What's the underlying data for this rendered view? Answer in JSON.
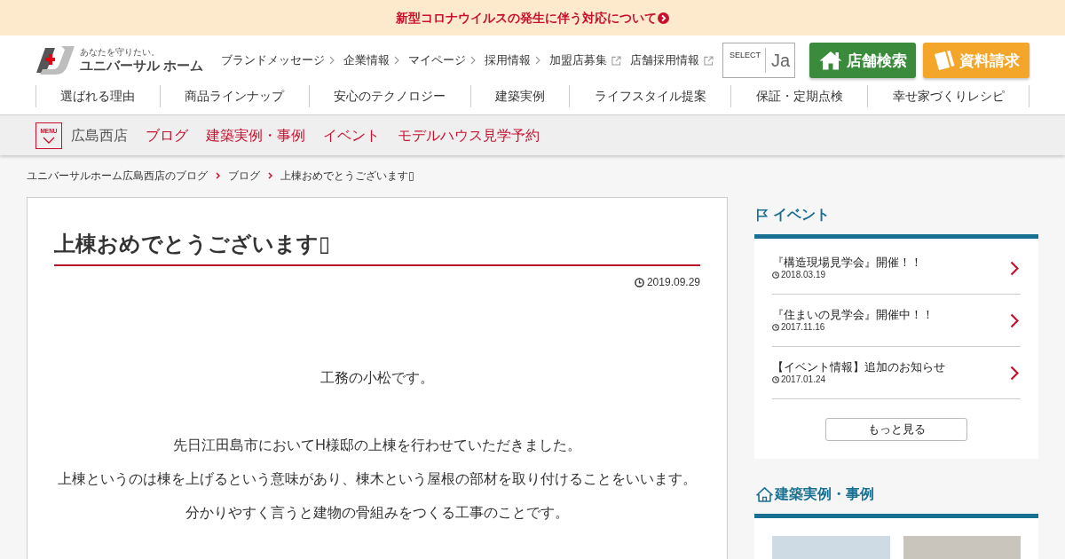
{
  "notice": {
    "text": "新型コロナウイルスの発生に伴う対応について"
  },
  "header": {
    "logo": {
      "tagline": "あなたを守りたい。",
      "name": "ユニバーサル ホーム"
    },
    "utility_links": [
      {
        "label": "ブランドメッセージ",
        "kind": "internal"
      },
      {
        "label": "企業情報",
        "kind": "internal"
      },
      {
        "label": "マイページ",
        "kind": "internal"
      },
      {
        "label": "採用情報",
        "kind": "internal"
      },
      {
        "label": "加盟店募集",
        "kind": "external"
      },
      {
        "label": "店舗採用情報",
        "kind": "external"
      }
    ],
    "language_select": {
      "label": "SELECT",
      "value": "Ja"
    },
    "buttons": [
      {
        "label": "店舗検索",
        "kind": "store"
      },
      {
        "label": "資料請求",
        "kind": "brochure"
      }
    ],
    "nav": [
      "選ばれる理由",
      "商品ラインナップ",
      "安心のテクノロジー",
      "建築実例",
      "ライフスタイル提案",
      "保証・定期点検",
      "幸せ家づくりレシピ"
    ]
  },
  "store_bar": {
    "menu_label": "MENU",
    "store_name": "広島西店",
    "links": [
      "ブログ",
      "建築実例・事例",
      "イベント",
      "モデルハウス見学予約"
    ]
  },
  "breadcrumb": [
    "ユニバーサルホーム広島西店のブログ",
    "ブログ",
    "上棟おめでとうございます▯"
  ],
  "article": {
    "title": "上棟おめでとうございます▯",
    "date": "2019.09.29",
    "paragraphs": [
      {
        "lines": [
          "工務の小松です。"
        ]
      },
      {
        "lines": [
          "先日江田島市においてH様邸の上棟を行わせていただきました。",
          "上棟というのは棟を上げるという意味があり、棟木という屋根の部材を取り付けることをいいます。",
          "分かりやすく言うと建物の骨組みをつくる工事のことです。"
        ]
      }
    ]
  },
  "sidebar": {
    "events": {
      "heading": "イベント",
      "items": [
        {
          "title": "『構造現場見学会』開催！！",
          "date": "2018.03.19"
        },
        {
          "title": "『住まいの見学会』開催中！！",
          "date": "2017.11.16"
        },
        {
          "title": "【イベント情報】追加のお知らせ",
          "date": "2017.01.24"
        }
      ],
      "more_button": "もっと見る"
    },
    "cases": {
      "heading": "建築実例・事例"
    }
  }
}
